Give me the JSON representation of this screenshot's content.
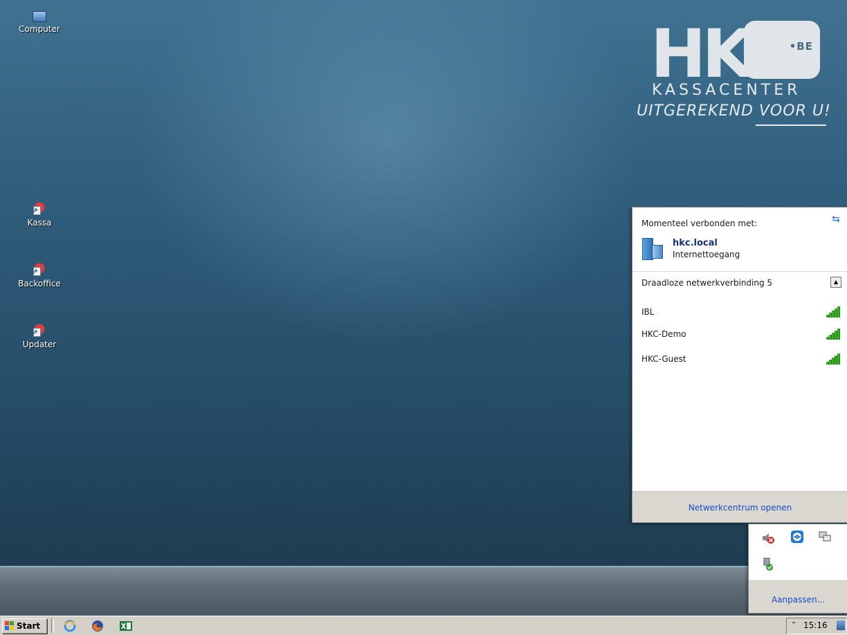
{
  "desktop": {
    "icons": [
      {
        "label": "Computer",
        "icon": "computer-icon"
      },
      {
        "label": "Kassa",
        "icon": "app-shortcut-icon"
      },
      {
        "label": "Backoffice",
        "icon": "app-shortcut-icon"
      },
      {
        "label": "Updater",
        "icon": "app-shortcut-icon"
      }
    ],
    "wallpaper_logo": {
      "mark": "HK",
      "domain": "•BE",
      "brand": "KASSACENTER",
      "slogan": "UITGEREKEND VOOR U!"
    }
  },
  "network_popup": {
    "header": "Momenteel verbonden met:",
    "connected": {
      "name": "hkc.local",
      "status": "Internettoegang"
    },
    "section_title": "Draadloze netwerkverbinding 5",
    "networks": [
      {
        "name": "IBL",
        "signal": 5
      },
      {
        "name": "HKC-Demo",
        "signal": 5
      },
      {
        "name": "HKC-Guest",
        "signal": 5
      }
    ],
    "footer_link": "Netwerkcentrum openen"
  },
  "tray_popup": {
    "icons": [
      "volume-muted-icon",
      "teamviewer-icon",
      "network-icon",
      "usb-safe-remove-icon"
    ],
    "footer_link": "Aanpassen..."
  },
  "taskbar": {
    "start_label": "Start",
    "quicklaunch": [
      "internet-explorer-icon",
      "firefox-icon",
      "excel-icon"
    ],
    "clock": "15:16"
  },
  "colors": {
    "link": "#1a4cc8",
    "signal": "#3cae2a",
    "desktop_blue": "#2f5d7c"
  }
}
